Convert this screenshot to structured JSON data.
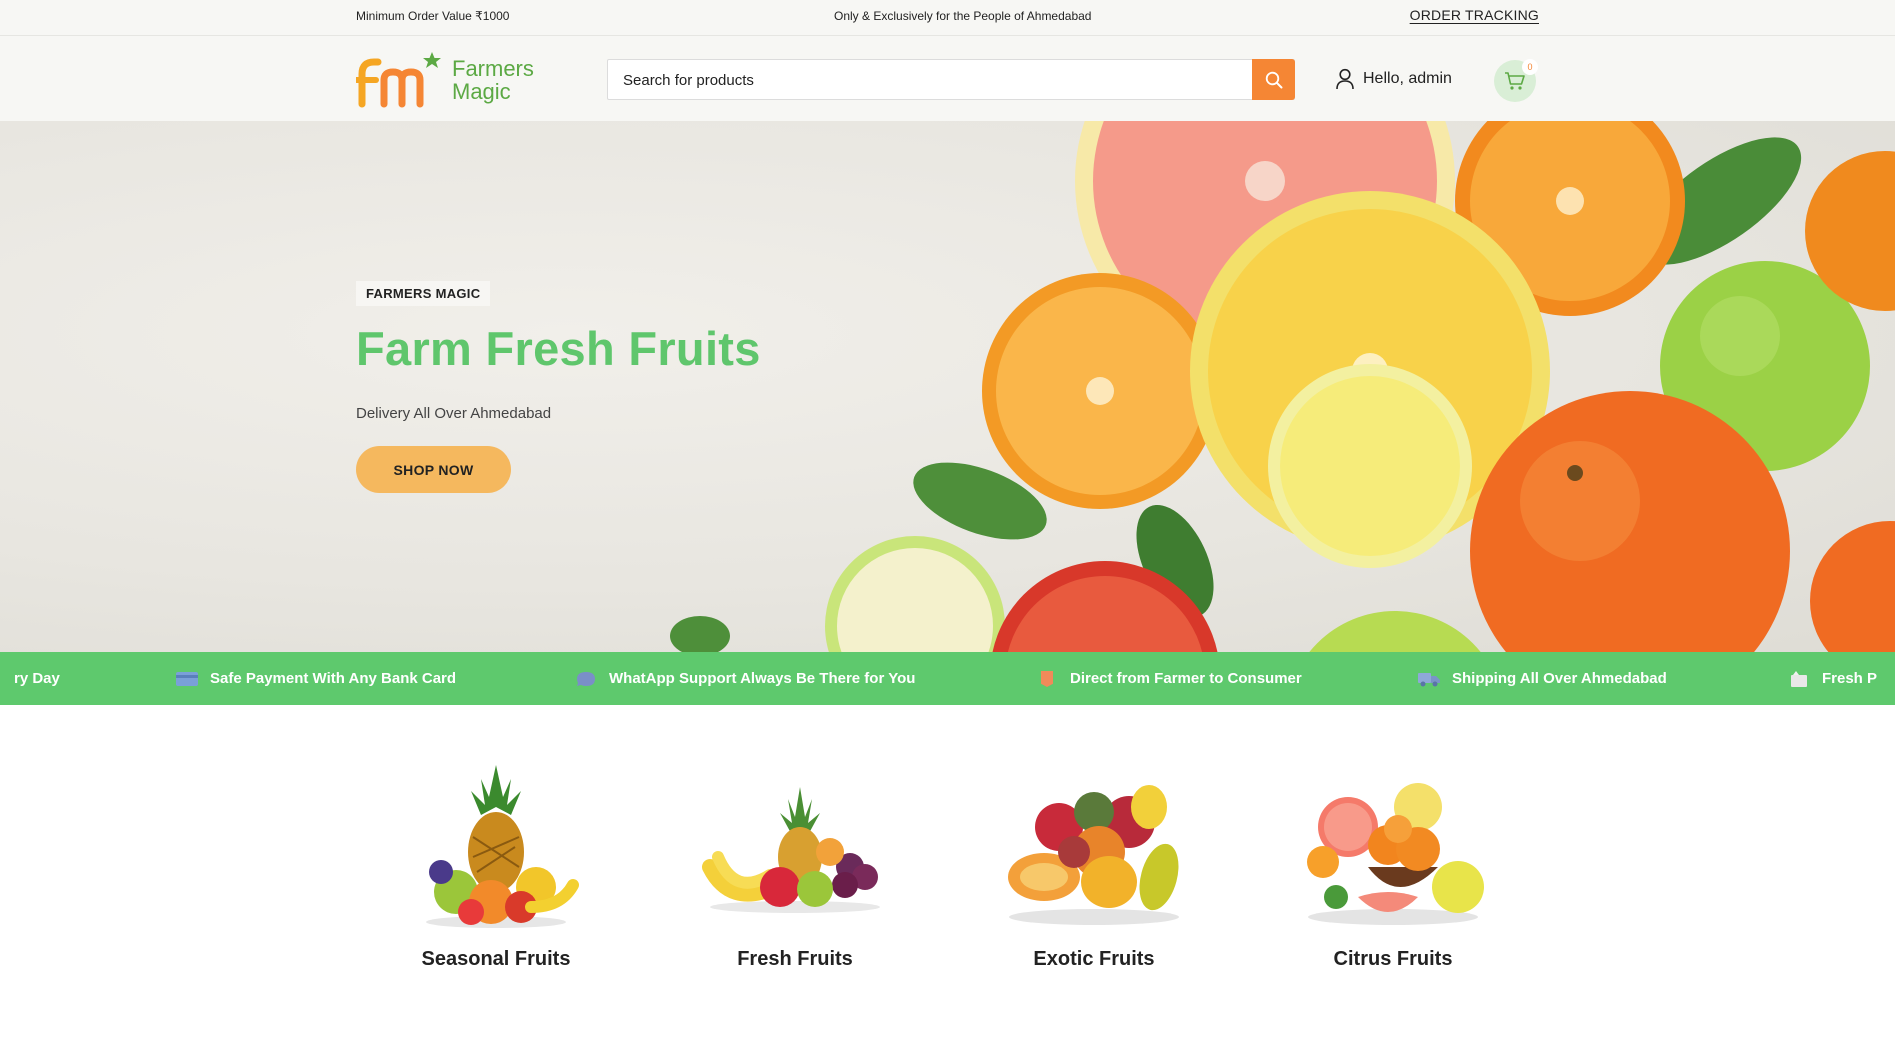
{
  "topbar": {
    "min_order": "Minimum Order Value ₹1000",
    "tagline": "Only & Exclusively for the People of Ahmedabad",
    "order_tracking": "ORDER TRACKING"
  },
  "header": {
    "logo_line1": "Farmers",
    "logo_line2": "Magic",
    "search_placeholder": "Search for products",
    "user_greeting": "Hello, admin",
    "cart_count": "0"
  },
  "hero": {
    "badge": "FARMERS MAGIC",
    "title": "Farm Fresh Fruits",
    "subtitle": "Delivery All Over Ahmedabad",
    "cta": "SHOP NOW"
  },
  "marquee": {
    "items": [
      {
        "text": "ry Day",
        "icon": ""
      },
      {
        "text": "Safe Payment With Any Bank Card",
        "icon": "credit-card-icon"
      },
      {
        "text": "WhatApp Support Always Be There for You",
        "icon": "chat-icon"
      },
      {
        "text": "Direct from Farmer to Consumer",
        "icon": "bookmark-icon"
      },
      {
        "text": "Shipping All Over Ahmedabad",
        "icon": "truck-icon"
      },
      {
        "text": "Fresh P",
        "icon": "leaf-box-icon"
      }
    ]
  },
  "categories": [
    {
      "label": "Seasonal Fruits"
    },
    {
      "label": "Fresh Fruits"
    },
    {
      "label": "Exotic Fruits"
    },
    {
      "label": "Citrus Fruits"
    }
  ],
  "colors": {
    "brand_green": "#5fc66c",
    "accent_orange": "#f58634",
    "cta_yellow": "#f5b85e"
  }
}
